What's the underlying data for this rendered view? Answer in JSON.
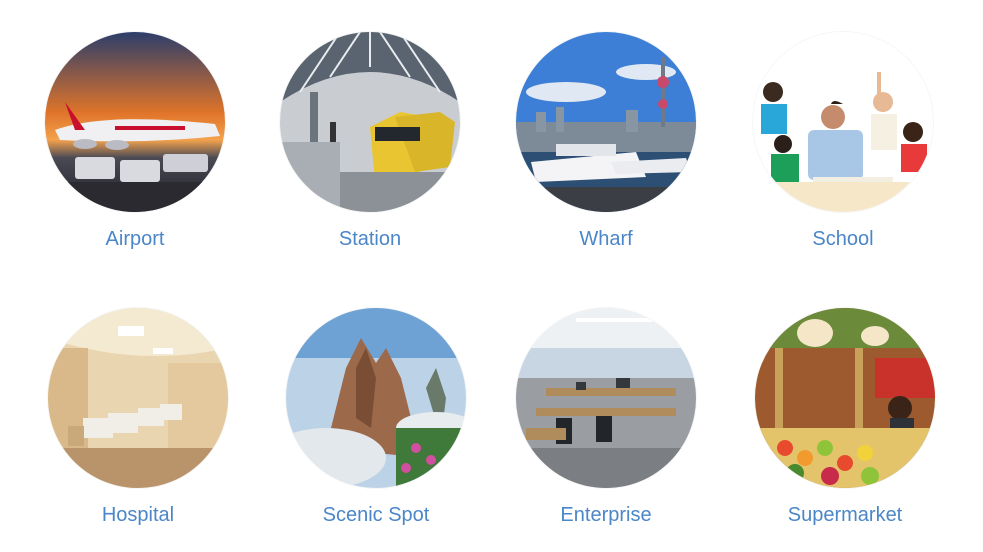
{
  "items": [
    {
      "label": "Airport"
    },
    {
      "label": "Station"
    },
    {
      "label": "Wharf"
    },
    {
      "label": "School"
    },
    {
      "label": "Hospital"
    },
    {
      "label": "Scenic Spot"
    },
    {
      "label": "Enterprise"
    },
    {
      "label": "Supermarket"
    }
  ],
  "colors": {
    "label": "#4a86c8",
    "background": "#ffffff"
  }
}
